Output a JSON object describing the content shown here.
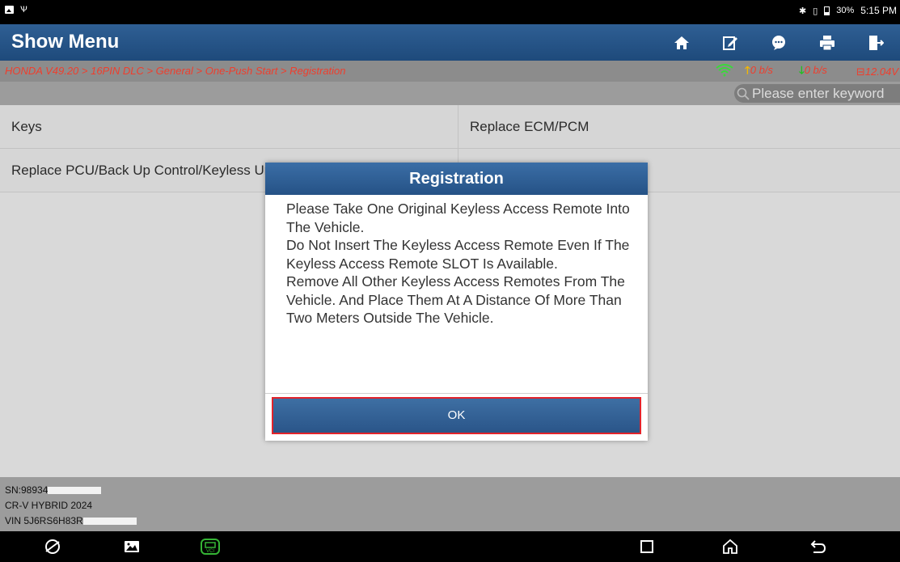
{
  "status_bar": {
    "battery": "30%",
    "time": "5:15 PM"
  },
  "header": {
    "title": "Show Menu",
    "icons": [
      "home-icon",
      "edit-report-icon",
      "feedback-icon",
      "print-icon",
      "exit-icon"
    ]
  },
  "breadcrumb": {
    "path": "HONDA V49.20 > 16PIN DLC > General > One-Push Start > Registration",
    "upload": "0 b/s",
    "download": "0 b/s",
    "voltage": "12.04V"
  },
  "search": {
    "placeholder": "Please enter keyword"
  },
  "menu": {
    "rows": [
      [
        "Keys",
        "Replace ECM/PCM"
      ],
      [
        "Replace PCU/Back Up Control/Keyless Unit",
        ""
      ]
    ]
  },
  "footer": {
    "sn": "SN:98934",
    "vehicle": "CR-V HYBRID 2024",
    "vin": "VIN 5J6RS6H83R"
  },
  "dialog": {
    "title": "Registration",
    "paragraphs": [
      "Please Take One Original Keyless Access Remote Into The Vehicle.",
      "Do Not Insert The Keyless Access Remote Even If The Keyless Access Remote SLOT Is Available.",
      "Remove All Other Keyless Access Remotes From The Vehicle. And Place Them At A Distance Of More Than Two Meters Outside The Vehicle."
    ],
    "ok_label": "OK"
  },
  "colors": {
    "header_blue": "#1e4a7b",
    "breadcrumb_red": "#ef3e2d",
    "highlight_red": "#e2232b",
    "wifi_green": "#3bd93b",
    "vci_green": "#35b535"
  }
}
